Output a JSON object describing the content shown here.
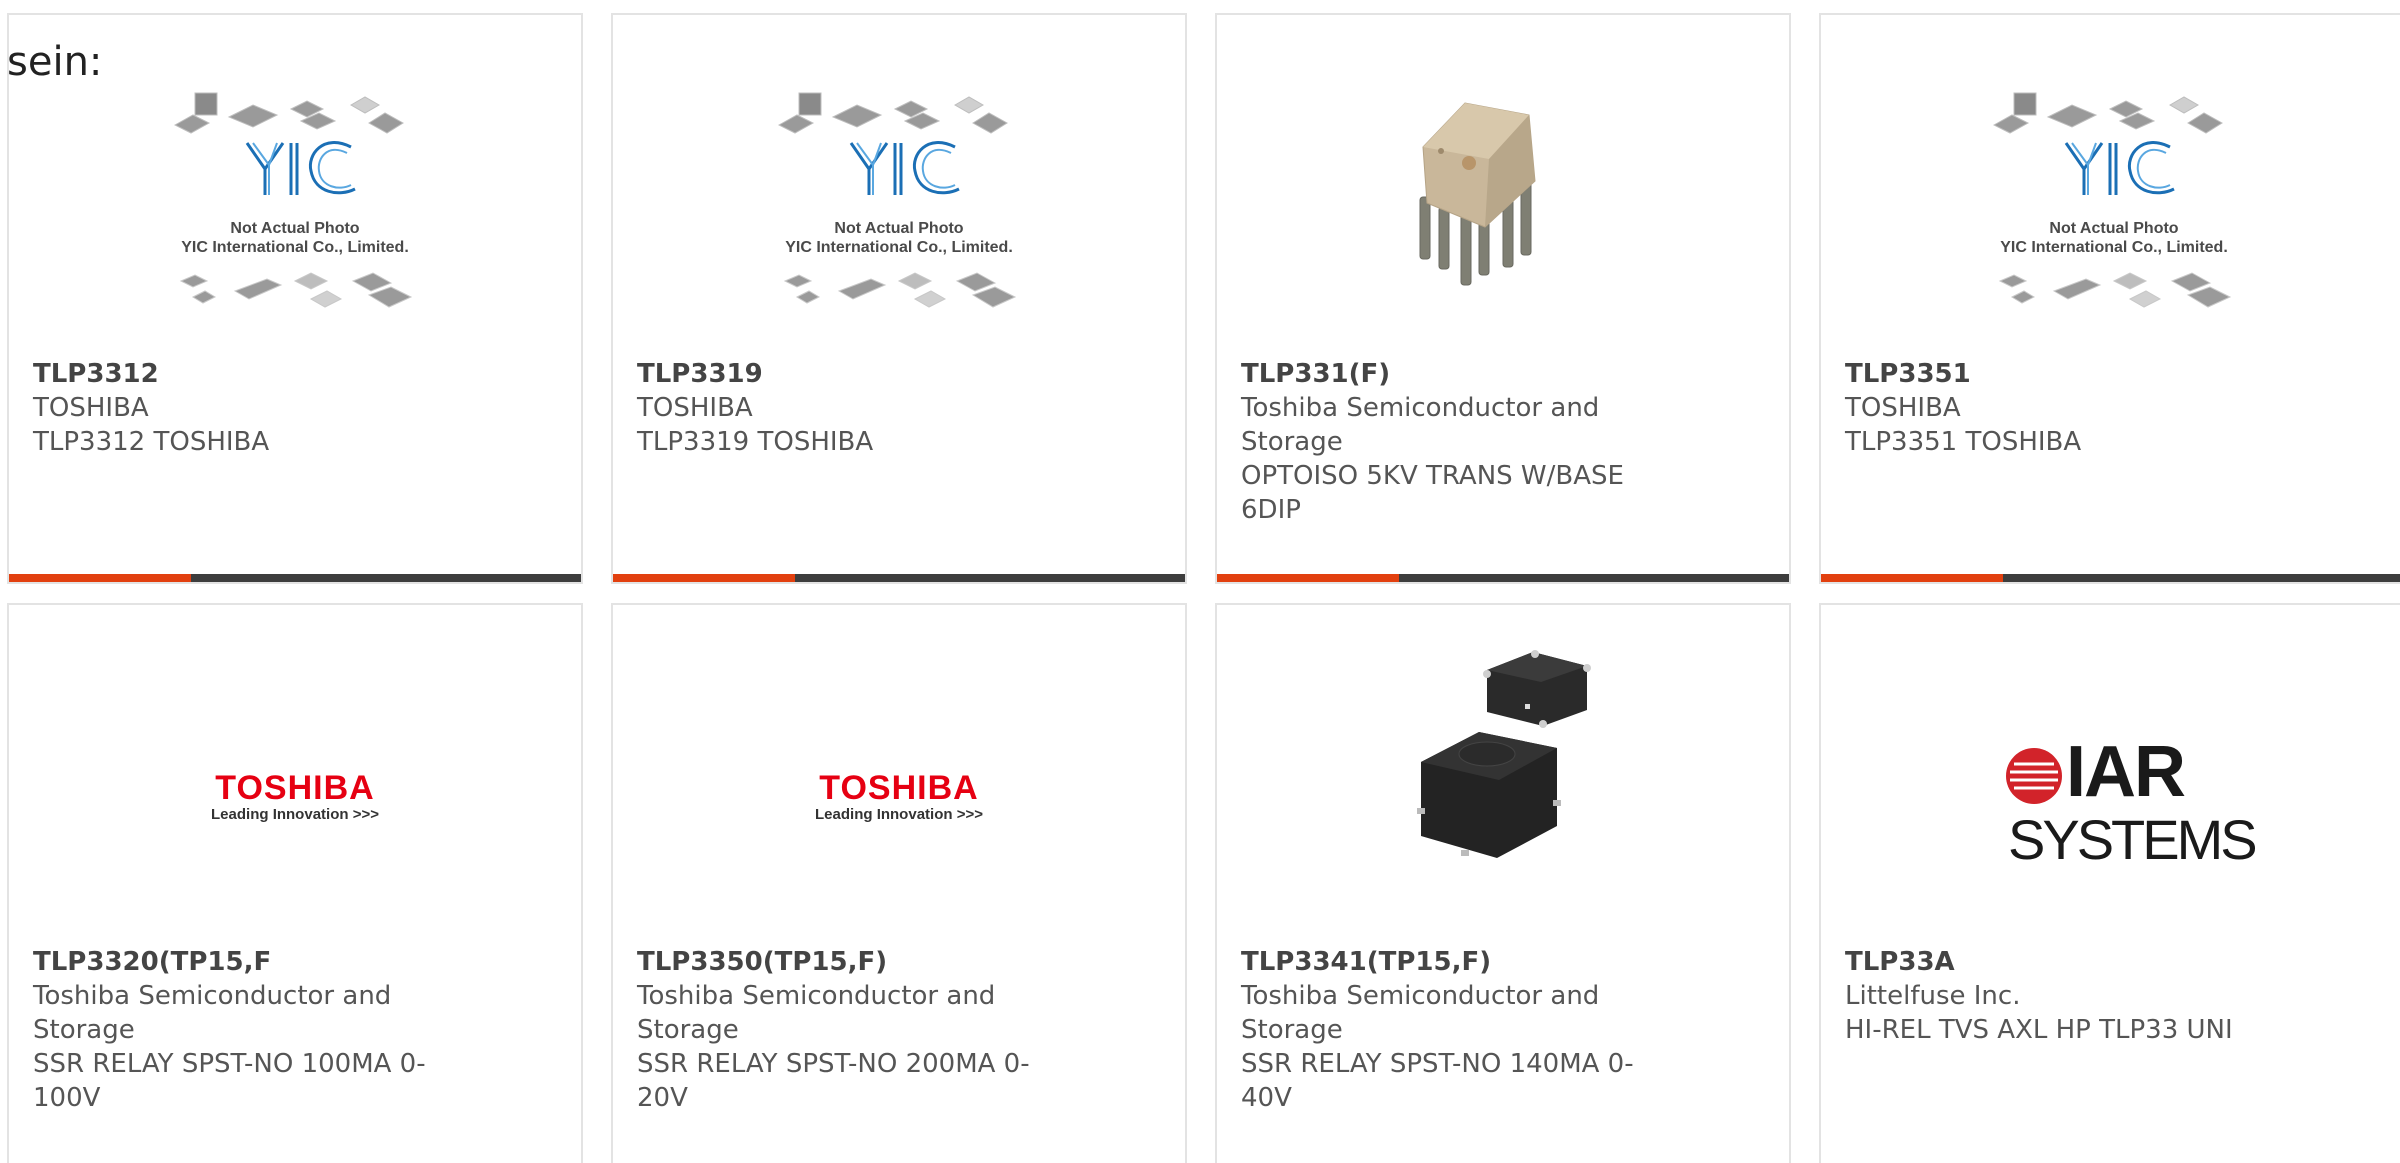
{
  "intro_text": "sein:",
  "placeholder": {
    "line1": "Not Actual Photo",
    "line2": "YIC International Co., Limited."
  },
  "toshiba_logo": {
    "brand": "TOSHIBA",
    "tagline": "Leading Innovation >>>"
  },
  "iar_logo": {
    "word": "IAR",
    "systems": "SYSTEMS"
  },
  "colors": {
    "accent": "#e2400f",
    "bar": "#3d3d3d",
    "toshiba_red": "#e60012",
    "iar_red": "#d2232a"
  },
  "products": [
    {
      "part": "TLP3312",
      "maker": "TOSHIBA",
      "desc": "TLP3312 TOSHIBA",
      "image": "yic-placeholder"
    },
    {
      "part": "TLP3319",
      "maker": "TOSHIBA",
      "desc": "TLP3319 TOSHIBA",
      "image": "yic-placeholder"
    },
    {
      "part": "TLP331(F)",
      "maker": "Toshiba Semiconductor and Storage",
      "desc": "OPTOISO 5KV TRANS W/BASE 6DIP",
      "image": "dip-ic-photo"
    },
    {
      "part": "TLP3351",
      "maker": "TOSHIBA",
      "desc": "TLP3351 TOSHIBA",
      "image": "yic-placeholder"
    },
    {
      "part": "TLP3320(TP15,F",
      "maker": "Toshiba Semiconductor and Storage",
      "desc": "SSR RELAY SPST-NO 100MA 0-100V",
      "image": "toshiba-logo"
    },
    {
      "part": "TLP3350(TP15,F)",
      "maker": "Toshiba Semiconductor and Storage",
      "desc": "SSR RELAY SPST-NO 200MA 0-20V",
      "image": "toshiba-logo"
    },
    {
      "part": "TLP3341(TP15,F)",
      "maker": "Toshiba Semiconductor and Storage",
      "desc": "SSR RELAY SPST-NO 140MA 0-40V",
      "image": "relay-photo"
    },
    {
      "part": "TLP33A",
      "maker": "Littelfuse Inc.",
      "desc": "HI-REL TVS AXL HP TLP33 UNI",
      "image": "iar-logo"
    }
  ]
}
